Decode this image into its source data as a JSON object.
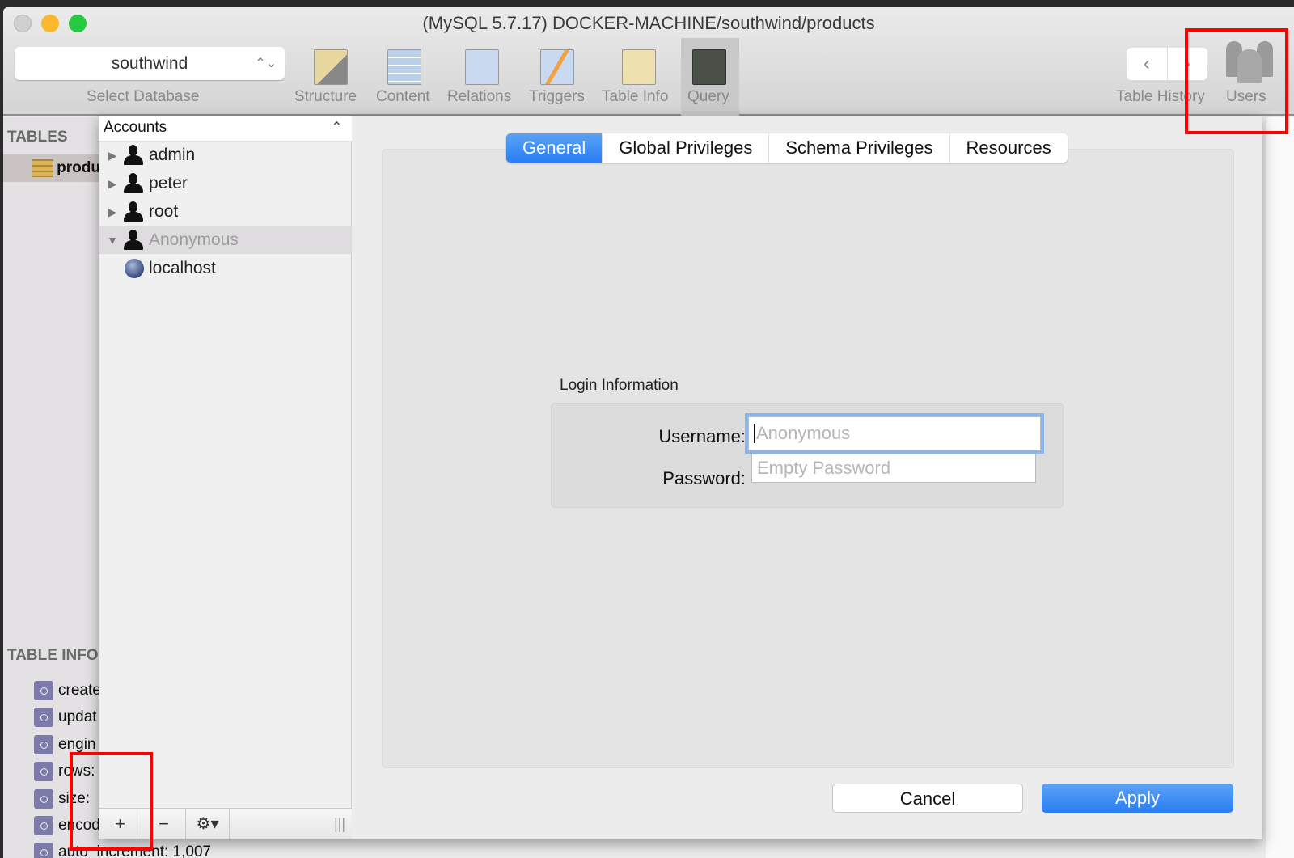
{
  "window": {
    "title": "(MySQL 5.7.17) DOCKER-MACHINE/southwind/products"
  },
  "toolbar": {
    "database": "southwind",
    "select_database_label": "Select Database",
    "items": [
      {
        "label": "Structure"
      },
      {
        "label": "Content"
      },
      {
        "label": "Relations"
      },
      {
        "label": "Triggers"
      },
      {
        "label": "Table Info"
      },
      {
        "label": "Query"
      }
    ],
    "table_history_label": "Table History",
    "users_label": "Users",
    "back_glyph": "‹",
    "forward_glyph": "›"
  },
  "sidebar": {
    "tables_header": "TABLES",
    "table": "produ",
    "table_info_header": "TABLE INFO",
    "info_items": [
      "create",
      "updat",
      "engin",
      "rows:",
      "size:",
      "encod",
      "auto_increment: 1,007"
    ]
  },
  "accounts": {
    "header": "Accounts",
    "rows": [
      {
        "label": "admin"
      },
      {
        "label": "peter"
      },
      {
        "label": "root"
      },
      {
        "label": "Anonymous"
      }
    ],
    "host": "localhost",
    "add": "+",
    "remove": "−",
    "gear": "⚙▾",
    "grip": "|||"
  },
  "tabs": [
    "General",
    "Global Privileges",
    "Schema Privileges",
    "Resources"
  ],
  "login": {
    "section_label": "Login Information",
    "username_label": "Username:",
    "username_placeholder": "Anonymous",
    "password_label": "Password:",
    "password_placeholder": "Empty Password"
  },
  "buttons": {
    "cancel": "Cancel",
    "apply": "Apply"
  },
  "colors": {
    "accent": "#2a7df2",
    "highlight": "#ff0000"
  }
}
